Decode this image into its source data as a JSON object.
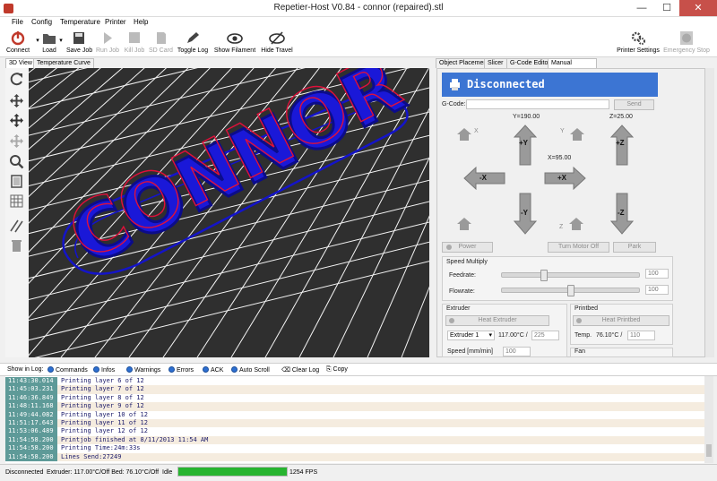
{
  "window": {
    "title": "Repetier-Host V0.84 - connor (repaired).stl",
    "minimize": "—",
    "maximize": "☐",
    "close": "✕"
  },
  "menu": [
    "File",
    "Config",
    "Temperature",
    "Printer",
    "Help"
  ],
  "toolbar": {
    "connect": "Connect",
    "load": "Load",
    "save_job": "Save Job",
    "run_job": "Run Job",
    "kill_job": "Kill Job",
    "sd_card": "SD Card",
    "toggle_log": "Toggle Log",
    "show_filament": "Show Filament",
    "hide_travel": "Hide Travel",
    "printer_settings": "Printer Settings",
    "emergency_stop": "Emergency Stop"
  },
  "left_tabs": [
    "3D View",
    "Temperature Curve"
  ],
  "right_tabs": [
    "Object Placement",
    "Slicer",
    "G-Code Editor",
    "Manual Control"
  ],
  "viewer": {
    "model_text": "CONNOR",
    "colors": {
      "background": "#333333",
      "grid": "#ffffff",
      "model": "#1010e0",
      "highlight": "#e01030"
    }
  },
  "manual": {
    "status": "Disconnected",
    "gcode_label": "G-Code:",
    "send": "Send",
    "y_pos": "Y=190.00",
    "z_pos": "Z=25.00",
    "x_pos": "X=95.00",
    "axis_x": "X",
    "axis_y": "Y",
    "axis_z": "Z",
    "plus_y": "+Y",
    "minus_y": "-Y",
    "plus_x": "+X",
    "minus_x": "-X",
    "plus_z": "+Z",
    "minus_z": "-Z",
    "power": "Power",
    "turn_motor_off": "Turn Motor Off",
    "park": "Park",
    "speed_multiply": "Speed Multiply",
    "feedrate": "Feedrate:",
    "feedrate_val": "100",
    "flowrate": "Flowrate:",
    "flowrate_val": "100",
    "feedrate_level": 0.3,
    "flowrate_level": 0.5,
    "extruder_group": "Extruder",
    "heat_extruder": "Heat Extruder",
    "extruder_select": "Extruder 1",
    "extruder_temp": "117.00°C /",
    "extruder_target": "225",
    "speed_label": "Speed [mm/min]",
    "speed_val": "100",
    "printbed_group": "Printbed",
    "heat_printbed": "Heat Printbed",
    "temp_label": "Temp.",
    "bed_temp": "76.10°C /",
    "bed_target": "110",
    "fan_group": "Fan"
  },
  "log_options": {
    "show_in_log": "Show in Log:",
    "commands": "Commands",
    "infos": "Infos",
    "warnings": "Warnings",
    "errors": "Errors",
    "ack": "ACK",
    "auto_scroll": "Auto Scroll",
    "clear_log": "Clear Log",
    "copy": "Copy"
  },
  "log": [
    {
      "time": "11:43:30.014",
      "msg": "Printing layer 6 of 12"
    },
    {
      "time": "11:45:03.231",
      "msg": "Printing layer 7 of 12"
    },
    {
      "time": "11:46:36.849",
      "msg": "Printing layer 8 of 12"
    },
    {
      "time": "11:48:11.168",
      "msg": "Printing layer 9 of 12"
    },
    {
      "time": "11:49:44.082",
      "msg": "Printing layer 10 of 12"
    },
    {
      "time": "11:51:17.643",
      "msg": "Printing layer 11 of 12"
    },
    {
      "time": "11:53:06.489",
      "msg": "Printing layer 12 of 12"
    },
    {
      "time": "11:54:58.200",
      "msg": "Printjob finished at 8/11/2013 11:54 AM"
    },
    {
      "time": "11:54:58.200",
      "msg": "Printing Time:24m:33s"
    },
    {
      "time": "11:54:58.200",
      "msg": "Lines Send:27249"
    }
  ],
  "status": {
    "connection": "Disconnected",
    "temps": "Extruder: 117.00°C/Off Bed: 76.10°C/Off",
    "state": "Idle",
    "progress": 1.0,
    "fps": "1254 FPS"
  }
}
